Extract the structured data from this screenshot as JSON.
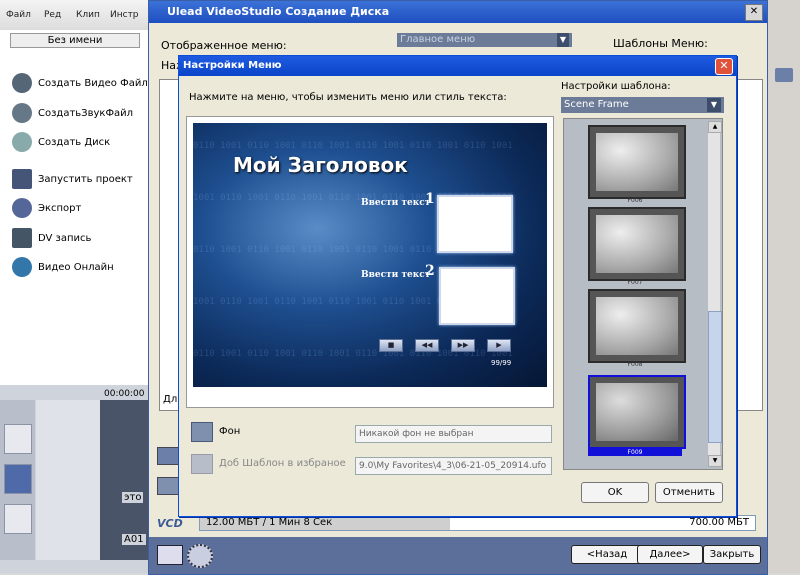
{
  "app": {
    "menu": [
      "Файл",
      "Ред",
      "Клип",
      "Инстр"
    ],
    "untitled": "Без имени",
    "sidebar": [
      {
        "label": "Создать Видео Файл",
        "icon": "film-icon"
      },
      {
        "label": "СоздатьЗвукФайл",
        "icon": "audio-icon"
      },
      {
        "label": "Создать Диск",
        "icon": "disc-icon"
      },
      {
        "label": "Запустить проект",
        "icon": "project-icon"
      },
      {
        "label": "Экспорт",
        "icon": "export-icon"
      },
      {
        "label": "DV запись",
        "icon": "dv-icon"
      },
      {
        "label": "Видео Онлайн",
        "icon": "online-icon"
      }
    ],
    "timecode": "00:00:00",
    "track_text_1": "это",
    "track_text_2": "A01"
  },
  "disc_window": {
    "title": "Ulead VideoStudio Создание Диска",
    "displayed_menu_label": "Отображенное меню:",
    "displayed_menu_value": "Главное меню",
    "menu_templates_label": "Шаблоны Меню:",
    "partial_label": "Наж",
    "dl_text": "Дл",
    "vcd_label": "VCD",
    "capacity_used": "12.00 МБТ / 1 Мин 8 Сек",
    "capacity_total": "700.00 МБТ",
    "buttons": {
      "back": "<Назад",
      "next": "Далее>",
      "close": "Закрыть"
    }
  },
  "menu_dialog": {
    "title": "Настройки Меню",
    "hint": "Нажмите  на меню, чтобы изменить меню или стиль текста:",
    "template_settings_label": "Настройки шаблона:",
    "template_value": "Scene Frame",
    "preview": {
      "title": "Мой Заголовок",
      "item1_text": "Ввести текст",
      "item1_num": "1",
      "item2_text": "Ввести текст",
      "item2_num": "2",
      "page": "99/99"
    },
    "templates": [
      {
        "caption": "F006",
        "selected": false
      },
      {
        "caption": "F007",
        "selected": false
      },
      {
        "caption": "F008",
        "selected": false
      },
      {
        "caption": "F009",
        "selected": true
      }
    ],
    "background_label": "Фон",
    "background_value": "Никакой фон не выбран",
    "add_template_label": "Доб Шаблон  в избраное",
    "add_template_value": "9.0\\My Favorites\\4_3\\06-21-05_20914.ufo",
    "ok": "OK",
    "cancel": "Отменить"
  },
  "colors": {
    "titlebar_active": "#0b45c9",
    "selected_template": "#1010d8"
  }
}
